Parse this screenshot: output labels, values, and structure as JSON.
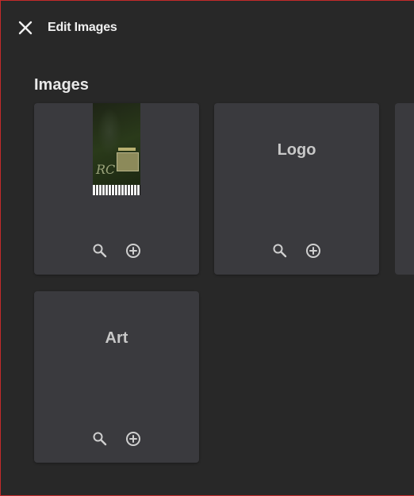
{
  "dialog": {
    "title": "Edit Images"
  },
  "section": {
    "title": "Images"
  },
  "cards": [
    {
      "label": "",
      "has_thumbnail": true
    },
    {
      "label": "Logo",
      "has_thumbnail": false
    },
    {
      "label": "Art",
      "has_thumbnail": false
    }
  ],
  "icons": {
    "close": "close-icon",
    "search": "search-icon",
    "add": "add-circle-icon"
  },
  "colors": {
    "background": "#282828",
    "card": "#3a3a3e",
    "text": "#eeeeee",
    "muted_text": "#c8c8c8",
    "icon": "#cfcfcf",
    "border_accent": "#c42b2b"
  }
}
